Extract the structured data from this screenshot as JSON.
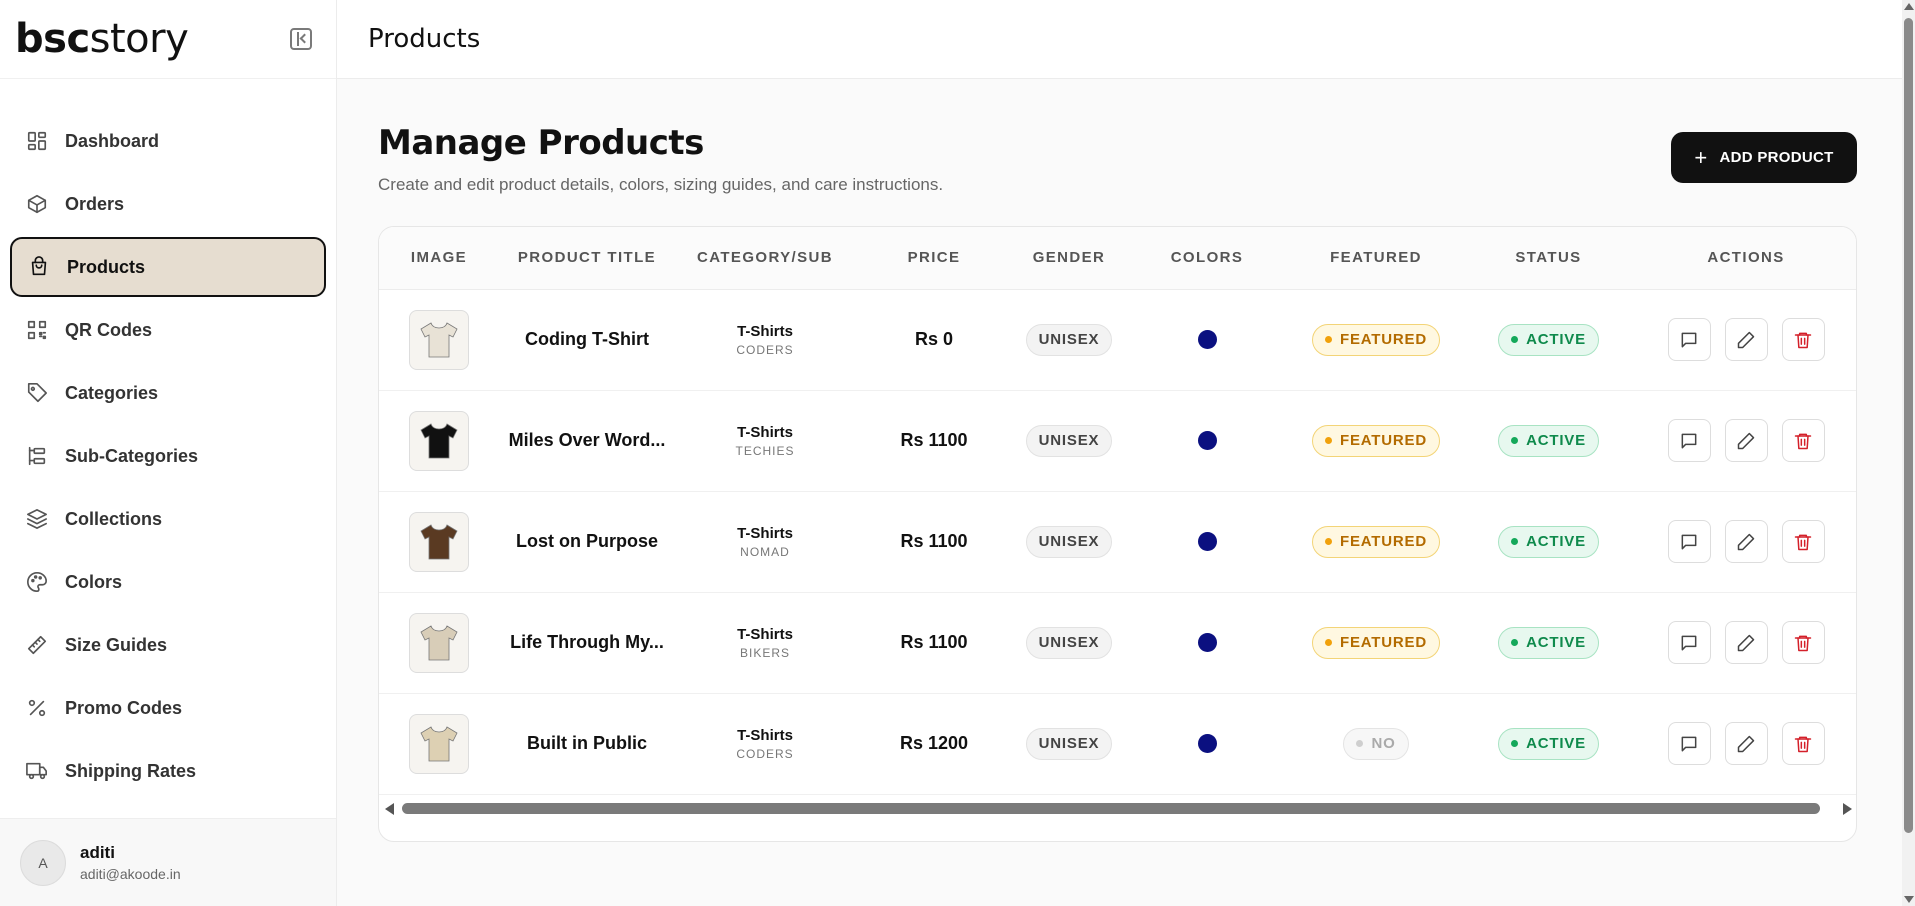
{
  "brand": {
    "logo_bold": "bsc",
    "logo_light": "story"
  },
  "sidebar": {
    "items": [
      {
        "label": "Dashboard",
        "icon": "dashboard-icon"
      },
      {
        "label": "Orders",
        "icon": "box-icon"
      },
      {
        "label": "Products",
        "icon": "bag-icon",
        "active": true
      },
      {
        "label": "QR Codes",
        "icon": "qr-code-icon"
      },
      {
        "label": "Categories",
        "icon": "tag-icon"
      },
      {
        "label": "Sub-Categories",
        "icon": "sub-categories-icon"
      },
      {
        "label": "Collections",
        "icon": "layers-icon"
      },
      {
        "label": "Colors",
        "icon": "palette-icon"
      },
      {
        "label": "Size Guides",
        "icon": "ruler-icon"
      },
      {
        "label": "Promo Codes",
        "icon": "percent-icon"
      },
      {
        "label": "Shipping Rates",
        "icon": "truck-icon"
      }
    ]
  },
  "user": {
    "initial": "A",
    "name": "aditi",
    "email": "aditi@akoode.in"
  },
  "topbar": {
    "title": "Products"
  },
  "page": {
    "title": "Manage Products",
    "subtitle": "Create and edit product details, colors, sizing guides, and care instructions.",
    "add_button": "ADD PRODUCT"
  },
  "table": {
    "headers": [
      "IMAGE",
      "PRODUCT TITLE",
      "CATEGORY/SUB",
      "PRICE",
      "GENDER",
      "COLORS",
      "FEATURED",
      "STATUS",
      "ACTIONS"
    ],
    "rows": [
      {
        "title": "Coding T-Shirt",
        "category": "T-Shirts",
        "sub": "CODERS",
        "price": "Rs 0",
        "gender": "UNISEX",
        "color": "#0b1080",
        "featured": "FEATURED",
        "is_featured": true,
        "status": "ACTIVE",
        "shirt_color": "#e8e2d6"
      },
      {
        "title": "Miles Over Word...",
        "category": "T-Shirts",
        "sub": "TECHIES",
        "price": "Rs 1100",
        "gender": "UNISEX",
        "color": "#0b1080",
        "featured": "FEATURED",
        "is_featured": true,
        "status": "ACTIVE",
        "shirt_color": "#111111"
      },
      {
        "title": "Lost on Purpose",
        "category": "T-Shirts",
        "sub": "NOMAD",
        "price": "Rs 1100",
        "gender": "UNISEX",
        "color": "#0b1080",
        "featured": "FEATURED",
        "is_featured": true,
        "status": "ACTIVE",
        "shirt_color": "#5a3a22"
      },
      {
        "title": "Life Through My...",
        "category": "T-Shirts",
        "sub": "BIKERS",
        "price": "Rs 1100",
        "gender": "UNISEX",
        "color": "#0b1080",
        "featured": "FEATURED",
        "is_featured": true,
        "status": "ACTIVE",
        "shirt_color": "#d8cdb8"
      },
      {
        "title": "Built in Public",
        "category": "T-Shirts",
        "sub": "CODERS",
        "price": "Rs 1200",
        "gender": "UNISEX",
        "color": "#0b1080",
        "featured": "NO",
        "is_featured": false,
        "status": "ACTIVE",
        "shirt_color": "#ddd0b3"
      }
    ]
  }
}
